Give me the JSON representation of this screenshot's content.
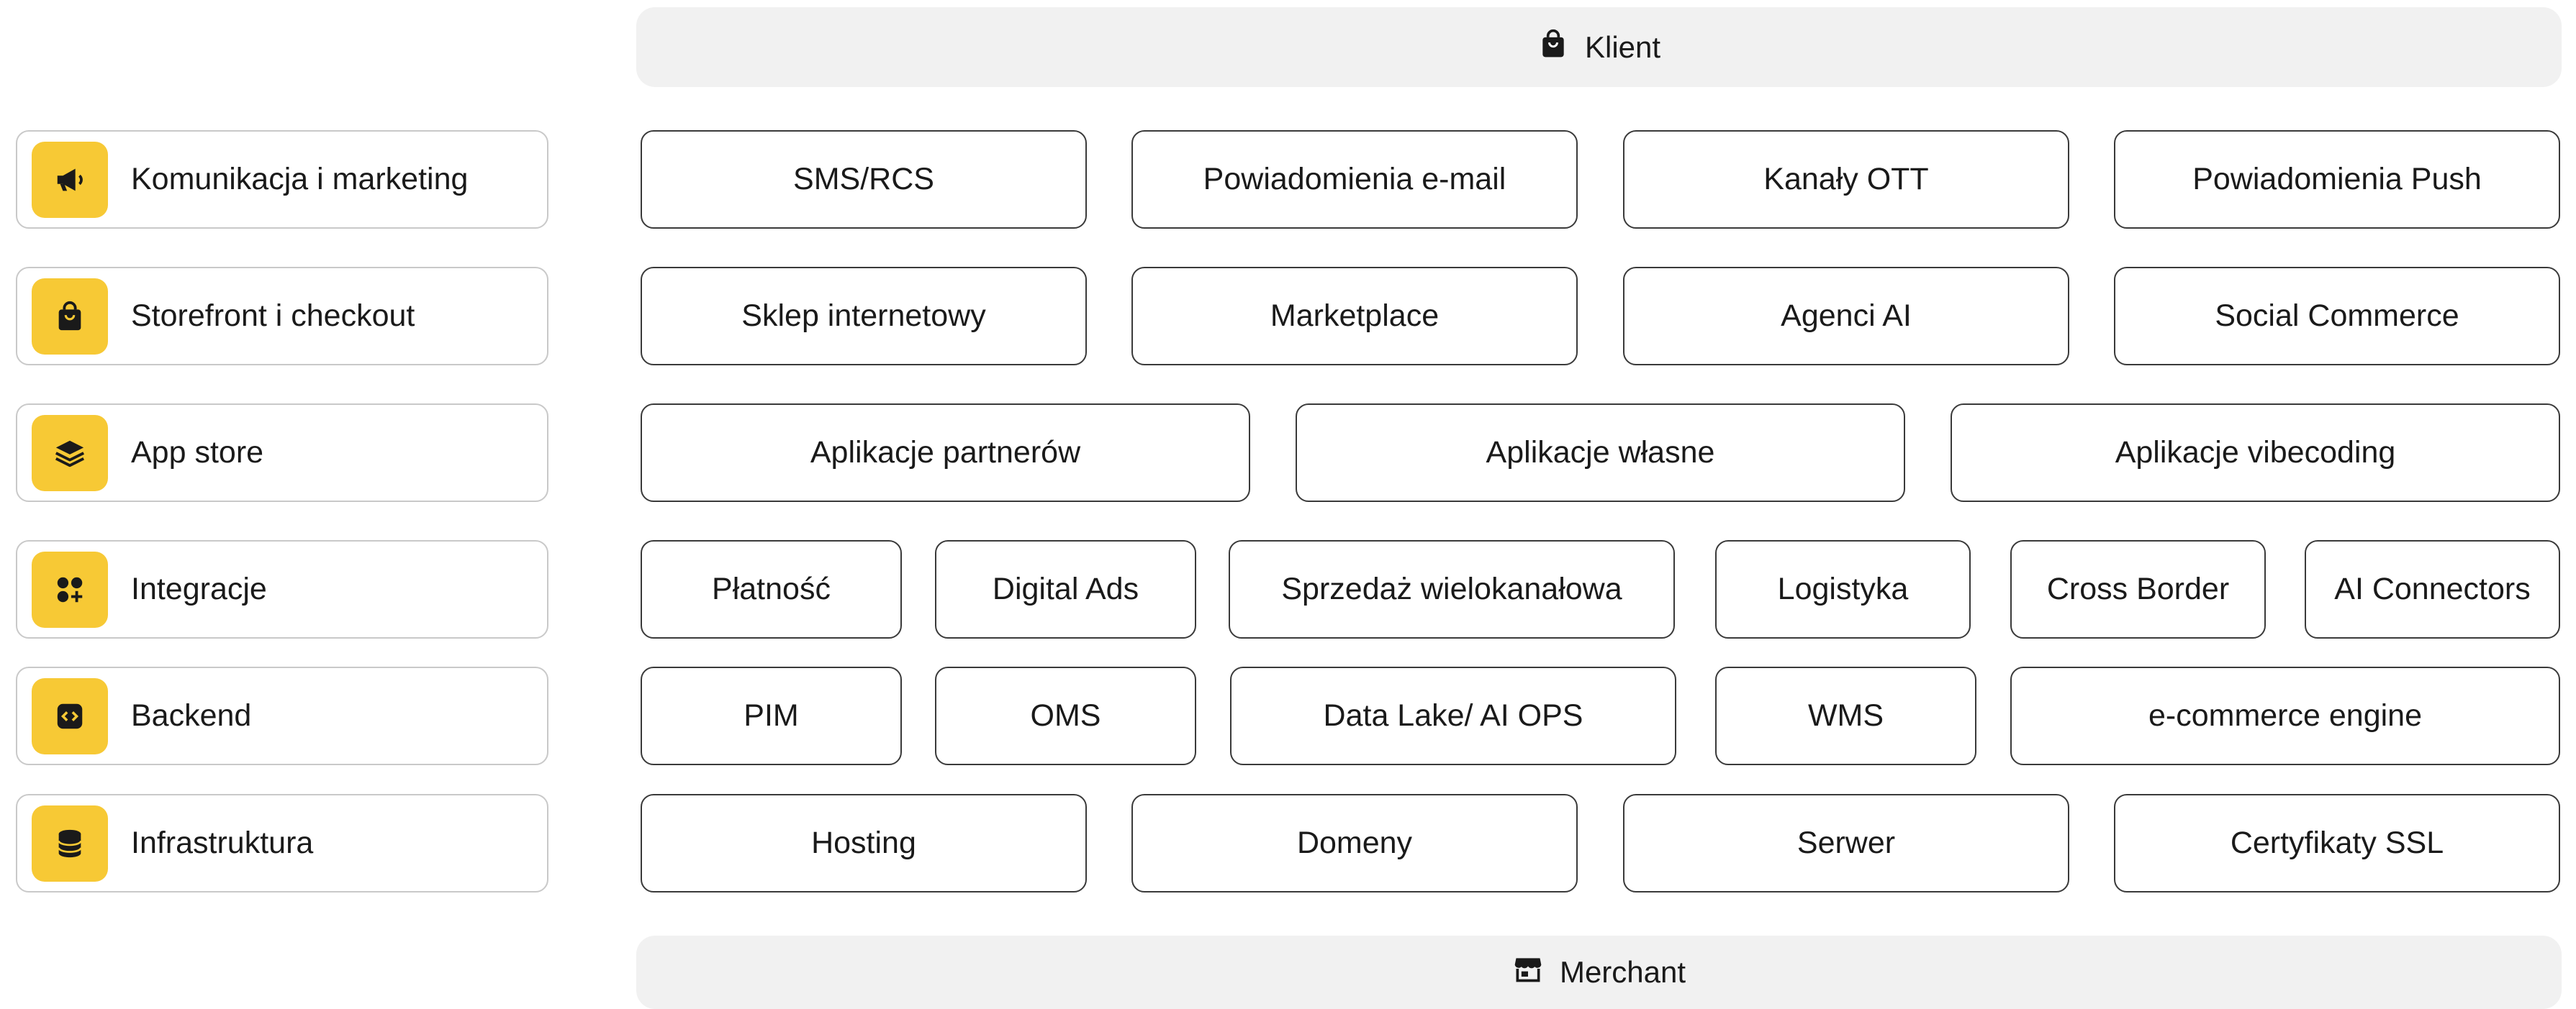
{
  "header": {
    "label": "Klient",
    "icon": "shopping-bag-icon"
  },
  "footer": {
    "label": "Merchant",
    "icon": "store-icon"
  },
  "accent_color": "#f7c935",
  "categories": [
    {
      "label": "Komunikacja i marketing",
      "icon": "megaphone-icon"
    },
    {
      "label": "Storefront i checkout",
      "icon": "shopping-bag-icon"
    },
    {
      "label": "App store",
      "icon": "layers-icon"
    },
    {
      "label": "Integracje",
      "icon": "apps-add-icon"
    },
    {
      "label": "Backend",
      "icon": "code-icon"
    },
    {
      "label": "Infrastruktura",
      "icon": "database-icon"
    }
  ],
  "rows": [
    [
      "SMS/RCS",
      "Powiadomienia e-mail",
      "Kanały OTT",
      "Powiadomienia Push"
    ],
    [
      "Sklep internetowy",
      "Marketplace",
      "Agenci AI",
      "Social Commerce"
    ],
    [
      "Aplikacje partnerów",
      "Aplikacje własne",
      "Aplikacje vibecoding"
    ],
    [
      "Płatność",
      "Digital Ads",
      "Sprzedaż wielokanałowa",
      "Logistyka",
      "Cross Border",
      "AI Connectors"
    ],
    [
      "PIM",
      "OMS",
      "Data Lake/ AI OPS",
      "WMS",
      "e-commerce engine"
    ],
    [
      "Hosting",
      "Domeny",
      "Serwer",
      "Certyfikaty SSL"
    ]
  ]
}
